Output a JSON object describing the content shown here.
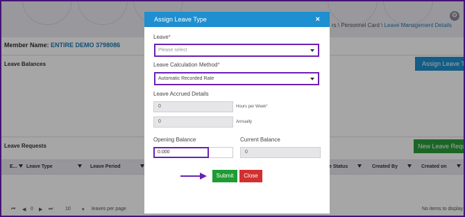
{
  "breadcrumb": {
    "prefix": "rs \\ Personnel Card \\ ",
    "current": "Leave Management Details"
  },
  "member": {
    "label": "Member Name:",
    "value": "ENTIRE DEMO 3798086"
  },
  "sections": {
    "balances": "Leave Balances",
    "requests": "Leave Requests"
  },
  "buttons": {
    "assign": "Assign Leave Type",
    "new_request": "New Leave Reques"
  },
  "grid": {
    "columns": [
      "E...",
      "Leave Type",
      "Leave Period",
      "e Status",
      "Created By",
      "Created on"
    ]
  },
  "pager": {
    "first": "⏮",
    "prev": "◀",
    "page": "0",
    "next": "▶",
    "last": "⏭",
    "page_size": "10",
    "per_page": "leaves per page",
    "no_items": "No items to display"
  },
  "modal": {
    "title": "Assign Leave Type",
    "close_icon": "×",
    "leave_label": "Leave",
    "leave_placeholder": "Please select",
    "method_label": "Leave Calculation Method",
    "method_value": "Automatic Recorded Rate",
    "accrued_label": "Leave Accrued Details",
    "hours_value": "0",
    "hours_unit": "Hours per Week",
    "annual_value": "0",
    "annual_unit": "Annually",
    "opening_label": "Opening Balance",
    "opening_value": "0.000",
    "current_label": "Current Balance",
    "current_value": "0",
    "submit": "Submit",
    "close": "Close",
    "required_mark": "*"
  },
  "colors": {
    "primary": "#1e8fd0",
    "success": "#1f9b34",
    "danger": "#d32f2f",
    "highlight": "#6a1fb5"
  }
}
